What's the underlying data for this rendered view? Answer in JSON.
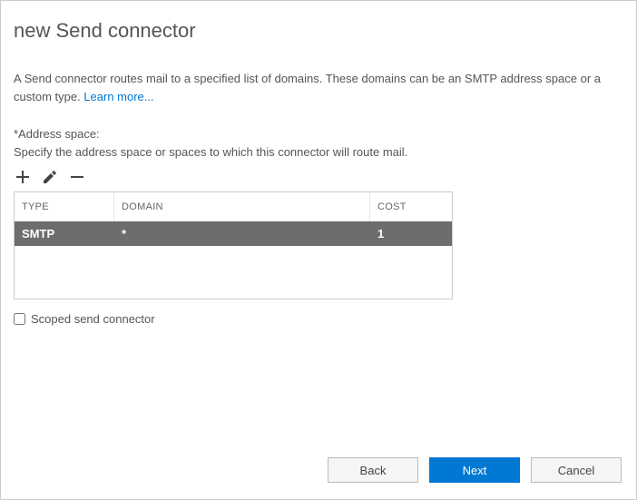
{
  "title": "new Send connector",
  "description": "A Send connector routes mail to a specified list of domains. These domains can be an SMTP address space or a custom type. ",
  "learn_more_label": "Learn more...",
  "address_space_label": "*Address space:",
  "address_space_hint": "Specify the address space or spaces to which this connector will route mail.",
  "table": {
    "headers": {
      "type": "TYPE",
      "domain": "DOMAIN",
      "cost": "COST"
    },
    "rows": [
      {
        "type": "SMTP",
        "domain": "*",
        "cost": "1"
      }
    ]
  },
  "scoped_label": "Scoped send connector",
  "scoped_checked": false,
  "footer": {
    "back": "Back",
    "next": "Next",
    "cancel": "Cancel"
  }
}
